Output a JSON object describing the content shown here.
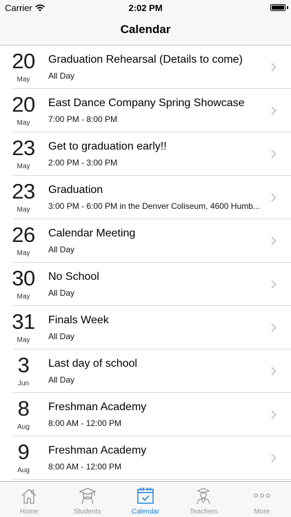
{
  "status_bar": {
    "carrier": "Carrier",
    "time": "2:02 PM"
  },
  "nav": {
    "title": "Calendar"
  },
  "events": [
    {
      "day": "20",
      "month": "May",
      "title": "Graduation Rehearsal (Details to come)",
      "subtitle": "All Day"
    },
    {
      "day": "20",
      "month": "May",
      "title": "East Dance Company Spring Showcase",
      "subtitle": "7:00 PM - 8:00 PM"
    },
    {
      "day": "23",
      "month": "May",
      "title": "Get to graduation early!!",
      "subtitle": "2:00 PM - 3:00 PM"
    },
    {
      "day": "23",
      "month": "May",
      "title": "Graduation",
      "subtitle": "3:00 PM - 6:00 PM in the Denver Coliseum, 4600 Humb..."
    },
    {
      "day": "26",
      "month": "May",
      "title": "Calendar Meeting",
      "subtitle": "All Day"
    },
    {
      "day": "30",
      "month": "May",
      "title": "No School",
      "subtitle": "All Day"
    },
    {
      "day": "31",
      "month": "May",
      "title": "Finals Week",
      "subtitle": "All Day"
    },
    {
      "day": "3",
      "month": "Jun",
      "title": "Last day of school",
      "subtitle": "All Day"
    },
    {
      "day": "8",
      "month": "Aug",
      "title": "Freshman Academy",
      "subtitle": "8:00 AM - 12:00 PM"
    },
    {
      "day": "9",
      "month": "Aug",
      "title": "Freshman Academy",
      "subtitle": "8:00 AM - 12:00 PM"
    }
  ],
  "tabs": [
    {
      "label": "Home",
      "icon": "home-icon",
      "active": false
    },
    {
      "label": "Students",
      "icon": "student-icon",
      "active": false
    },
    {
      "label": "Calendar",
      "icon": "calendar-icon",
      "active": true
    },
    {
      "label": "Teachers",
      "icon": "teacher-icon",
      "active": false
    },
    {
      "label": "More",
      "icon": "more-icon",
      "active": false
    }
  ],
  "colors": {
    "accent": "#1a7dd7",
    "inactive_tab": "#929292",
    "bar_background": "#f7f7f7"
  }
}
